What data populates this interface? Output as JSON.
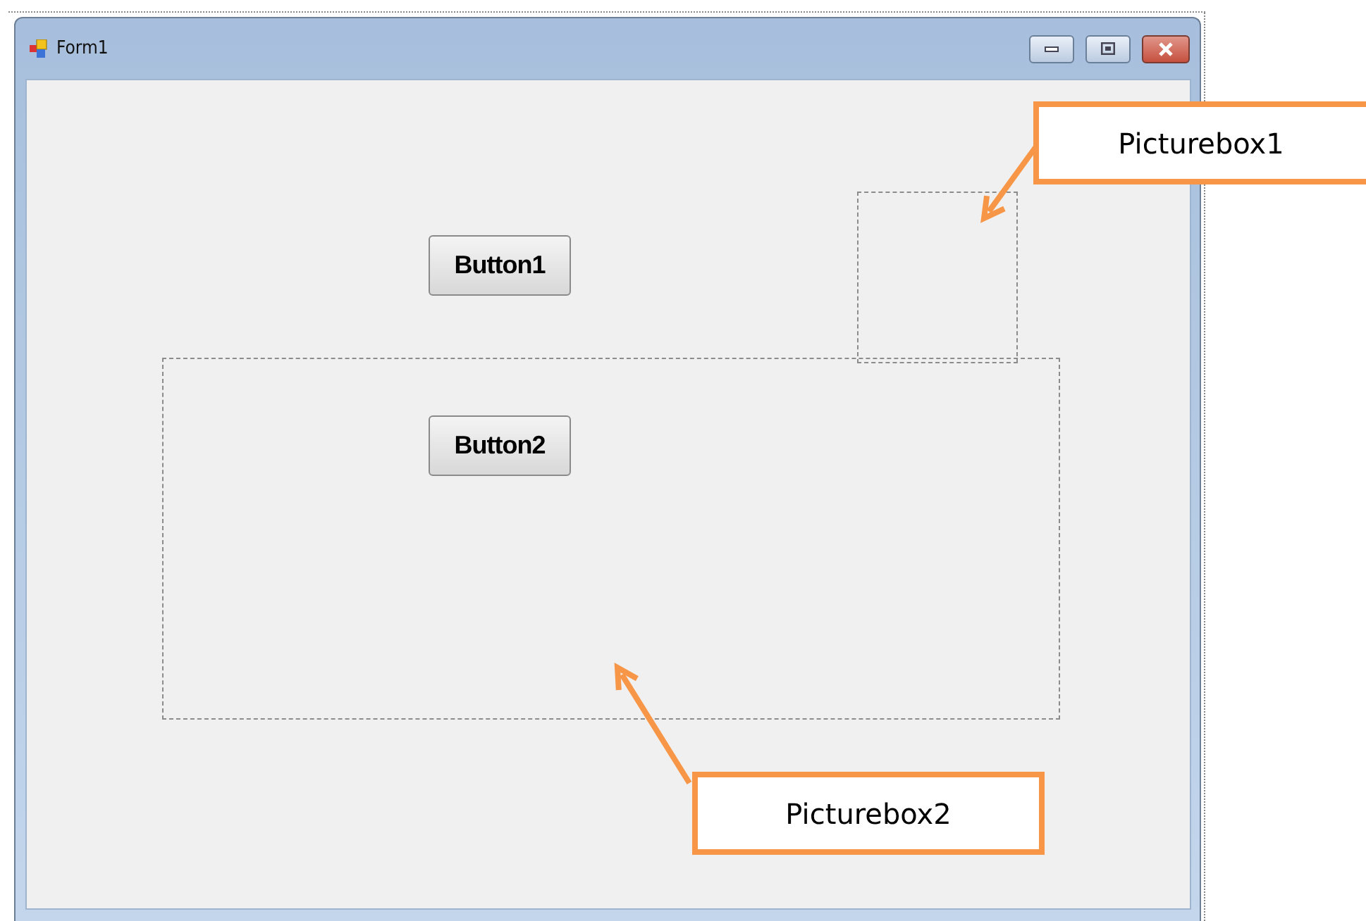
{
  "window": {
    "title": "Form1"
  },
  "buttons": [
    "Button1",
    "Button2"
  ],
  "callouts": [
    "Picturebox1",
    "Picturebox2"
  ]
}
